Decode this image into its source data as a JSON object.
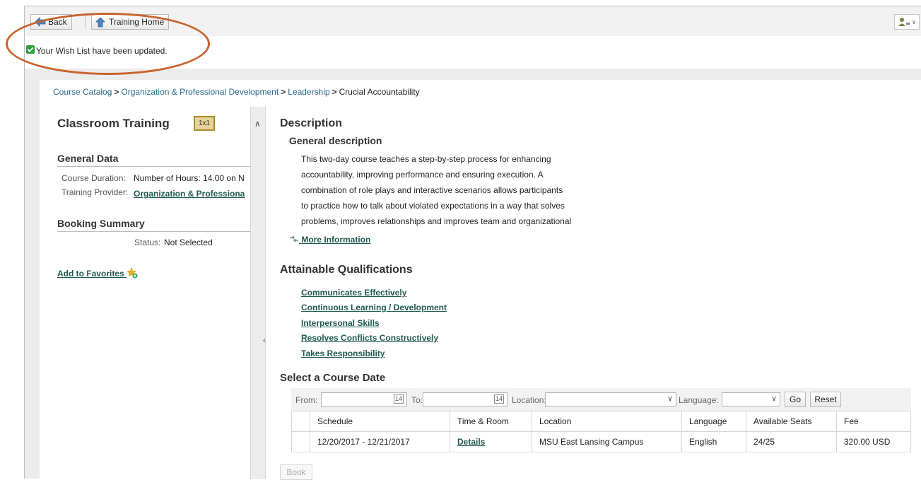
{
  "toolbar": {
    "back_label": "Back",
    "home_label": "Training Home"
  },
  "message": {
    "text": "Your Wish List have been updated."
  },
  "breadcrumb": [
    "Course Catalog",
    "Organization & Professional Development",
    "Leadership",
    "Crucial Accountability"
  ],
  "left": {
    "title": "Classroom Training",
    "badge": "1x1",
    "general_heading": "General Data",
    "duration_label": "Course Duration:",
    "duration_value": "Number of Hours: 14.00 on N",
    "provider_label": "Training Provider:",
    "provider_value": "Organization & Professiona",
    "booking_heading": "Booking Summary",
    "status_label": "Status:",
    "status_value": "Not Selected",
    "favorites_link": "Add to Favorites"
  },
  "description": {
    "heading": "Description",
    "subheading": "General description",
    "lines": [
      "This two-day course teaches a step-by-step process for enhancing",
      "accountability, improving performance and ensuring execution. A",
      "combination of role plays and interactive scenarios allows participants",
      "to practice how to talk about violated expectations in a way that solves",
      "problems, improves relationships and improves team and organizational"
    ],
    "more_info": "More Information"
  },
  "qualifications": {
    "heading": "Attainable Qualifications",
    "items": [
      "Communicates Effectively",
      "Continuous Learning / Development",
      "Interpersonal Skills",
      "Resolves Conflicts Constructively",
      "Takes Responsibility"
    ]
  },
  "course_date": {
    "heading": "Select a Course Date",
    "filters": {
      "from_label": "From:",
      "to_label": "To:",
      "location_label": "Location:",
      "language_label": "Language:",
      "go_label": "Go",
      "reset_label": "Reset"
    },
    "columns": [
      "Schedule",
      "Time & Room",
      "Location",
      "Language",
      "Available Seats",
      "Fee"
    ],
    "rows": [
      {
        "schedule": "12/20/2017 - 12/21/2017",
        "time_room": "Details",
        "location": "MSU East Lansing Campus",
        "language": "English",
        "seats": "24/25",
        "fee": "320.00 USD"
      }
    ],
    "book_label": "Book"
  },
  "colors": {
    "annotation": "#c8622d",
    "link": "#1f5a4f",
    "breadcrumb_link": "#2a6a8c",
    "success": "#2e9e3e"
  }
}
